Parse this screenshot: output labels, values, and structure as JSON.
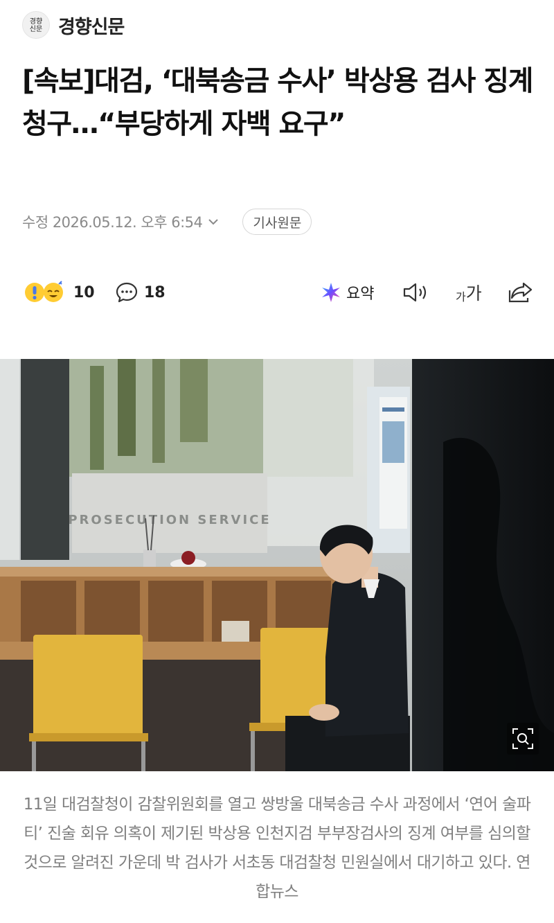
{
  "press": {
    "logo_text": "경향\n신문",
    "name": "경향신문"
  },
  "article": {
    "headline": "[속보]대검, ‘대북송금 수사’ 박상용 검사 징계 청구…“부당하게 자백 요구”",
    "date": "수정 2026.05.12. 오후 6:54",
    "original_link_label": "기사원문"
  },
  "toolbar": {
    "reaction_count": "10",
    "comment_count": "18",
    "summary_label": "요약",
    "font_small": "가",
    "font_large": "가"
  },
  "photo": {
    "signboard_text": "PROSECUTION SERVICE",
    "icons": [
      "zoom-icon"
    ]
  },
  "caption": "11일 대검찰청이 감찰위원회를 열고 쌍방울 대북송금 수사 과정에서 ‘연어 술파티’ 진술 회유 의혹이 제기된 박상용 인천지검 부부장검사의 징계 여부를 심의할 것으로 알려진 가운데 박 검사가 서초동 대검찰청 민원실에서 대기하고 있다. 연합뉴스",
  "colors": {
    "text_primary": "#111111",
    "text_meta": "#8a8a8a",
    "caption": "#7f7f7f",
    "summary_icon": "#6c4dff"
  }
}
